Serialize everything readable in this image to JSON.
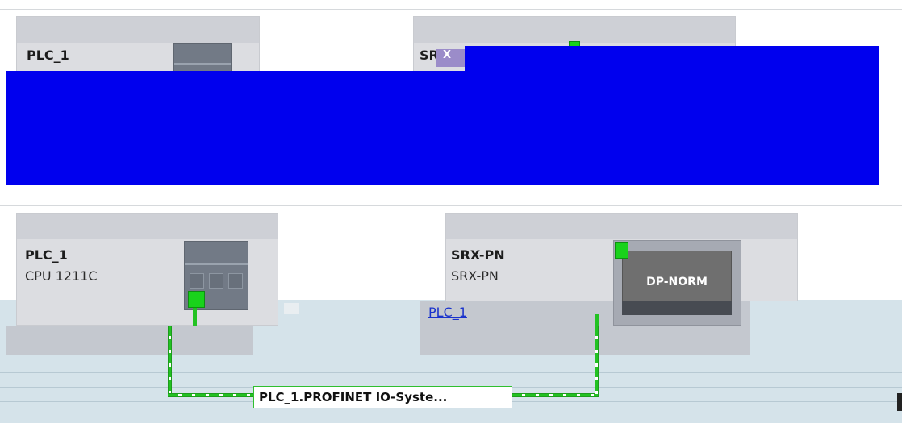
{
  "upper_view": {
    "plc_card": {
      "title": "PLC_1"
    },
    "io_card": {
      "title_partial": "SR",
      "overlay_glyph": "X"
    }
  },
  "lower_view": {
    "plc_card": {
      "title": "PLC_1",
      "subtitle": "CPU 1211C"
    },
    "io_card": {
      "title": "SRX-PN",
      "subtitle": "SRX-PN",
      "controller_link": "PLC_1",
      "module_label": "DP-NORM"
    },
    "network": {
      "label": "PLC_1.PROFINET IO-Syste..."
    }
  },
  "colors": {
    "port_green": "#19d21b",
    "network_dash": "#22c222",
    "card_bg": "#dcdde1",
    "redaction_blue": "#0000ee",
    "network_area": "#d5e3ea"
  }
}
